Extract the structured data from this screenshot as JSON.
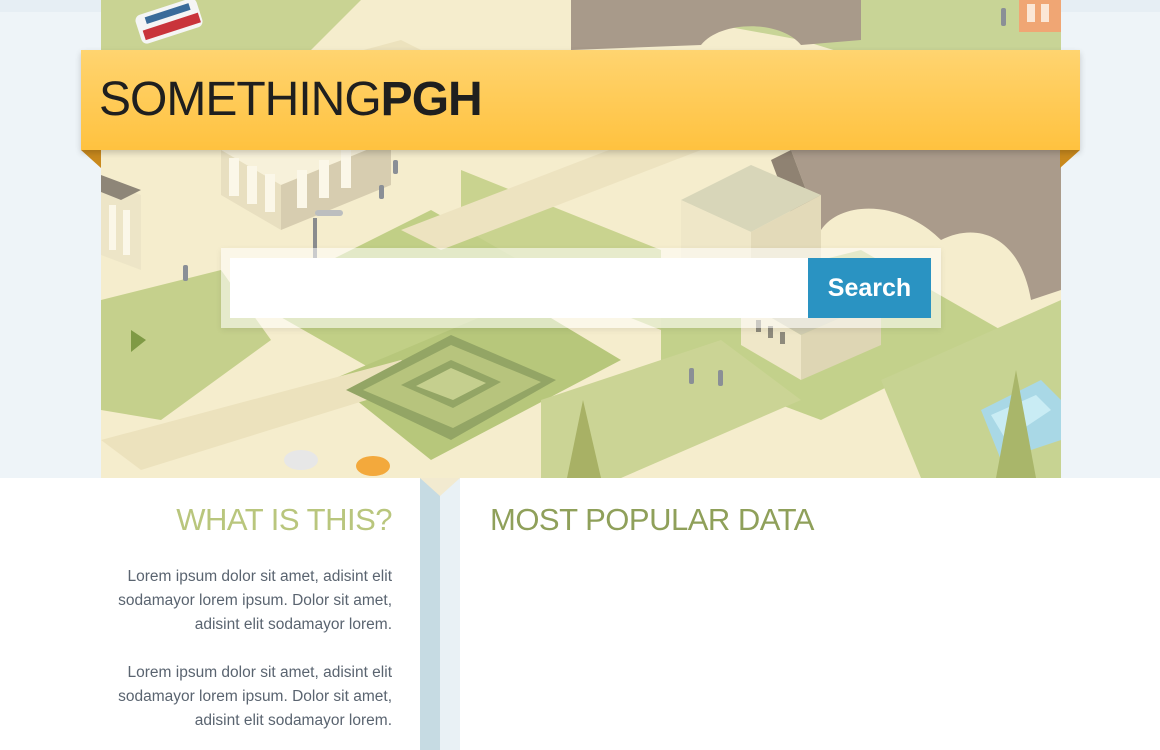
{
  "header": {
    "logo_light": "SOMETHING",
    "logo_bold": "PGH"
  },
  "search": {
    "placeholder": "",
    "button_label": "Search"
  },
  "about": {
    "title": "WHAT IS THIS?",
    "paragraphs": [
      "Lorem ipsum dolor sit amet, adisint elit sodamayor lorem ipsum. Dolor sit amet, adisint elit sodamayor lorem.",
      "Lorem ipsum dolor sit amet, adisint elit sodamayor lorem ipsum. Dolor sit amet, adisint elit sodamayor lorem."
    ]
  },
  "popular": {
    "title": "MOST POPULAR DATA"
  },
  "colors": {
    "banner": "#ffc23f",
    "search_button": "#2a93c2",
    "what_title": "#b9c67d",
    "popular_title": "#8fa05a",
    "divider": "#c6dbe3"
  }
}
